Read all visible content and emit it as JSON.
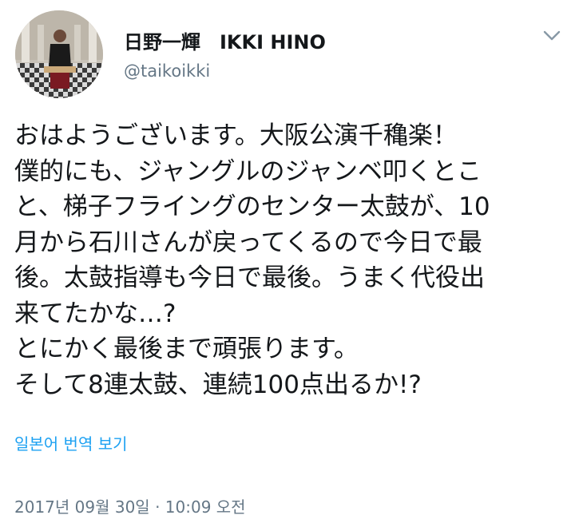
{
  "header": {
    "display_name": "日野一輝　IKKI HINO",
    "handle": "@taikoikki",
    "avatar_icon": "profile-photo",
    "menu_icon": "chevron-down-icon"
  },
  "tweet": {
    "lines": [
      "おはようございます。大阪公演千穐楽！",
      "僕的にも、ジャングルのジャンベ叩くとこ",
      "と、梯子フライングのセンター太鼓が、10",
      "月から石川さんが戻ってくるので今日で最",
      "後。太鼓指導も今日で最後。うまく代役出",
      "来てたかな…?",
      "とにかく最後まで頑張ります。",
      "そして8連太鼓、連続100点出るか!?"
    ]
  },
  "translate": {
    "label": "일본어 번역 보기"
  },
  "timestamp": "2017년 09월 30일 · 10:09 오전",
  "colors": {
    "link": "#1da1f2",
    "secondary": "#657786",
    "text": "#14171a"
  }
}
